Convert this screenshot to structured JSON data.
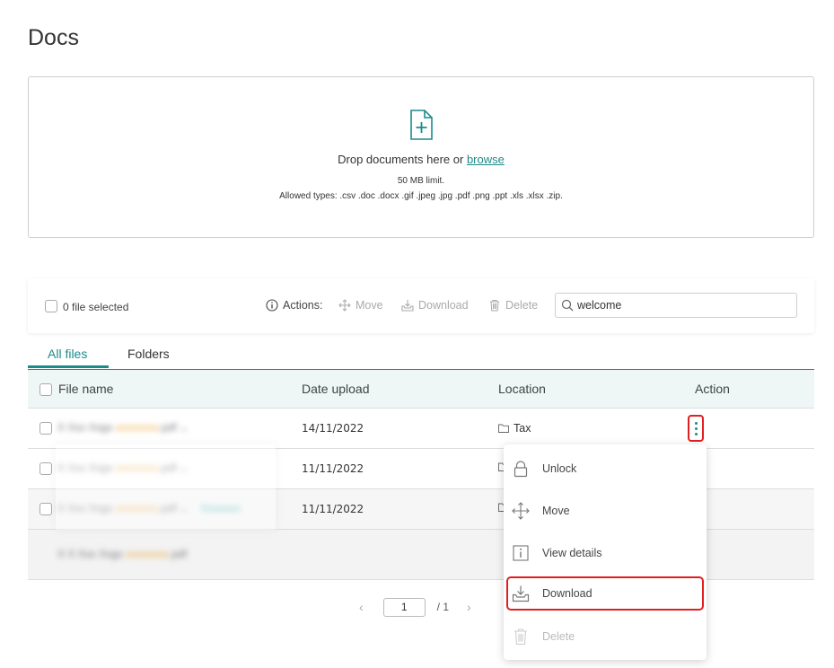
{
  "page": {
    "title": "Docs"
  },
  "dropzone": {
    "main_text": "Drop documents here or",
    "browse_label": "browse",
    "limit_text": "50 MB limit.",
    "types_text": "Allowed types: .csv .doc .docx .gif .jpeg .jpg .pdf .png .ppt .xls .xlsx .zip."
  },
  "toolbar": {
    "selected_label": "0 file selected",
    "actions_label": "Actions:",
    "move_label": "Move",
    "download_label": "Download",
    "delete_label": "Delete",
    "search_value": "welcome"
  },
  "tabs": [
    {
      "label": "All files",
      "active": true
    },
    {
      "label": "Folders",
      "active": false
    }
  ],
  "table": {
    "headers": [
      "File name",
      "Date upload",
      "Location",
      "Action"
    ],
    "rows": [
      {
        "file_name": "",
        "date": "14/11/2022",
        "location": "Tax"
      },
      {
        "file_name": "",
        "date": "11/11/2022",
        "location": ""
      },
      {
        "file_name": "",
        "date": "11/11/2022",
        "location": ""
      },
      {
        "file_name": "",
        "date": "",
        "location": ""
      }
    ]
  },
  "pagination": {
    "current_page": "1",
    "total": "/ 1"
  },
  "context_menu": {
    "items": [
      {
        "label": "Unlock",
        "icon": "lock-icon",
        "disabled": false
      },
      {
        "label": "Move",
        "icon": "move-icon",
        "disabled": false
      },
      {
        "label": "View details",
        "icon": "info-icon",
        "disabled": false
      },
      {
        "label": "Download",
        "icon": "download-icon",
        "disabled": false,
        "highlighted": true
      },
      {
        "label": "Delete",
        "icon": "trash-icon",
        "disabled": true
      }
    ]
  },
  "colors": {
    "accent": "#1d8a8a",
    "highlight": "#e02020",
    "header_bg": "#eef6f6"
  }
}
